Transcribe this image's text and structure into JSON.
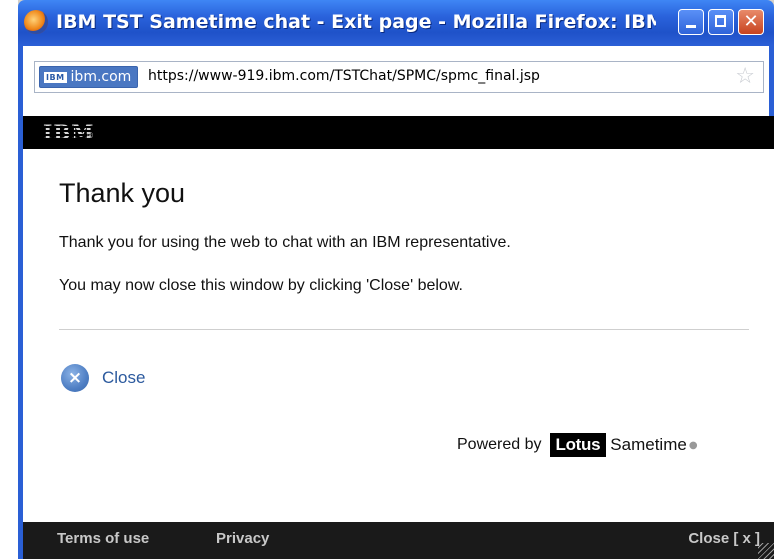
{
  "window": {
    "title": "IBM TST Sametime chat - Exit page - Mozilla Firefox: IBM E...",
    "buttons": {
      "minimize": "minimize",
      "maximize": "maximize",
      "close": "close"
    }
  },
  "urlbar": {
    "site_badge": "IBM",
    "site_domain": "ibm.com",
    "url": "https://www-919.ibm.com/TSTChat/SPMC/spmc_final.jsp"
  },
  "page": {
    "header_logo": "IBM",
    "heading": "Thank you",
    "line1": "Thank you for using the web to chat with an IBM representative.",
    "line2": "You may now close this window by clicking 'Close' below.",
    "close_icon": "×",
    "close_label": "Close",
    "powered_by": "Powered by",
    "lotus": "Lotus",
    "sametime": "Sametime",
    "footer": {
      "terms": "Terms of use",
      "privacy": "Privacy",
      "close": "Close [ x ]"
    }
  },
  "colors": {
    "titlebar": "#2a63dc",
    "header": "#000000",
    "link": "#2c5a9e",
    "footer": "#1a1a1a"
  }
}
